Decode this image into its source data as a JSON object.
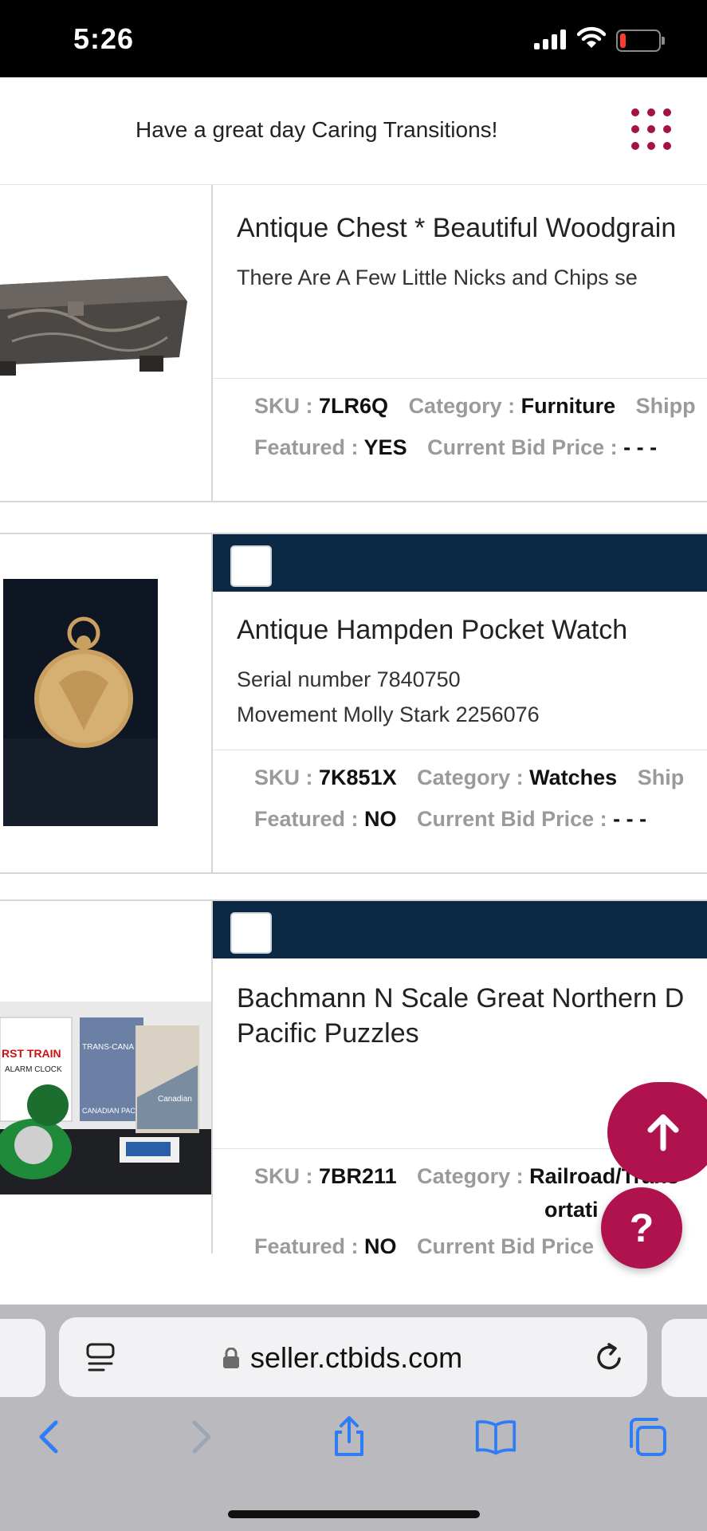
{
  "status_bar": {
    "time": "5:26",
    "battery_level": 0.15,
    "battery_color": "#ff3b30"
  },
  "header": {
    "greeting": "Have a great day Caring Transitions!",
    "menu_icon": "grid-dots-icon",
    "accent_color": "#a4124a"
  },
  "labels": {
    "sku": "SKU :",
    "category": "Category :",
    "featured": "Featured :",
    "current_bid": "Current Bid Price :",
    "shipping_partial": "Shipp",
    "shipping_partial_2": "Ship"
  },
  "items": [
    {
      "title": "Antique Chest * Beautiful Woodgrain",
      "desc1": "There Are A Few Little Nicks and Chips se",
      "sku": "7LR6Q",
      "category": "Furniture",
      "featured": "YES",
      "bid": "- - -"
    },
    {
      "title": "Antique Hampden Pocket Watch",
      "desc1": "Serial number 7840750",
      "desc2": "Movement Molly Stark 2256076",
      "sku": "7K851X",
      "category": "Watches",
      "featured": "NO",
      "bid": "- - -"
    },
    {
      "title": "Bachmann N Scale Great Northern D",
      "title2": "Pacific Puzzles",
      "sku": "7BR211",
      "category": "Railroad/Trans",
      "category2": "ortati",
      "featured": "NO",
      "bid_partial": "Current Bid Price"
    }
  ],
  "photo_text": {
    "train_clock": "RST TRAIN",
    "alarm_clock": "ALARM CLOCK",
    "puzzle1": "TRANS-CANA LIMITE",
    "puzzle2": "Canadian",
    "puzzle1_sub": "CANADIAN PAC"
  },
  "fab": {
    "scroll_top_icon": "arrow-up-icon",
    "help_label": "?"
  },
  "browser": {
    "url": "seller.ctbids.com"
  },
  "colors": {
    "navy": "#0b2945",
    "crimson": "#b0124d",
    "ios_blue": "#2f7df6"
  }
}
